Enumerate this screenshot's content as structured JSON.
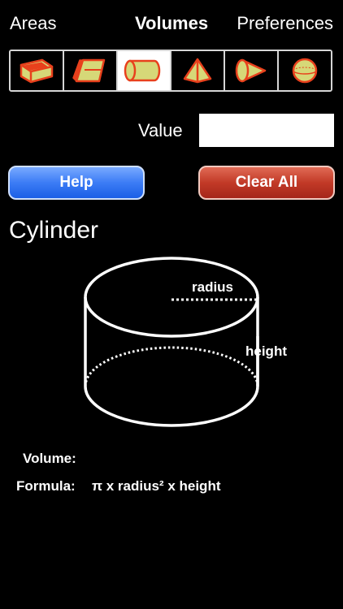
{
  "nav": {
    "areas": "Areas",
    "volumes": "Volumes",
    "preferences": "Preferences"
  },
  "shapes": [
    {
      "icon": "box-icon",
      "selected": false
    },
    {
      "icon": "prism-icon",
      "selected": false
    },
    {
      "icon": "cylinder-icon",
      "selected": true
    },
    {
      "icon": "pyramid-icon",
      "selected": false
    },
    {
      "icon": "cone-icon",
      "selected": false
    },
    {
      "icon": "sphere-icon",
      "selected": false
    }
  ],
  "value_field": {
    "label": "Value",
    "value": ""
  },
  "buttons": {
    "help": "Help",
    "clear_all": "Clear All"
  },
  "shape_title": "Cylinder",
  "diagram": {
    "radius_label": "radius",
    "height_label": "height"
  },
  "results": {
    "volume_label": "Volume:",
    "volume_value": "",
    "formula_label": "Formula:",
    "formula": "π x radius² x height"
  },
  "colors": {
    "icon_fill": "#d6d878",
    "icon_stroke": "#e8401c",
    "help_button": "#2f6ff0",
    "clear_button": "#b83222"
  }
}
